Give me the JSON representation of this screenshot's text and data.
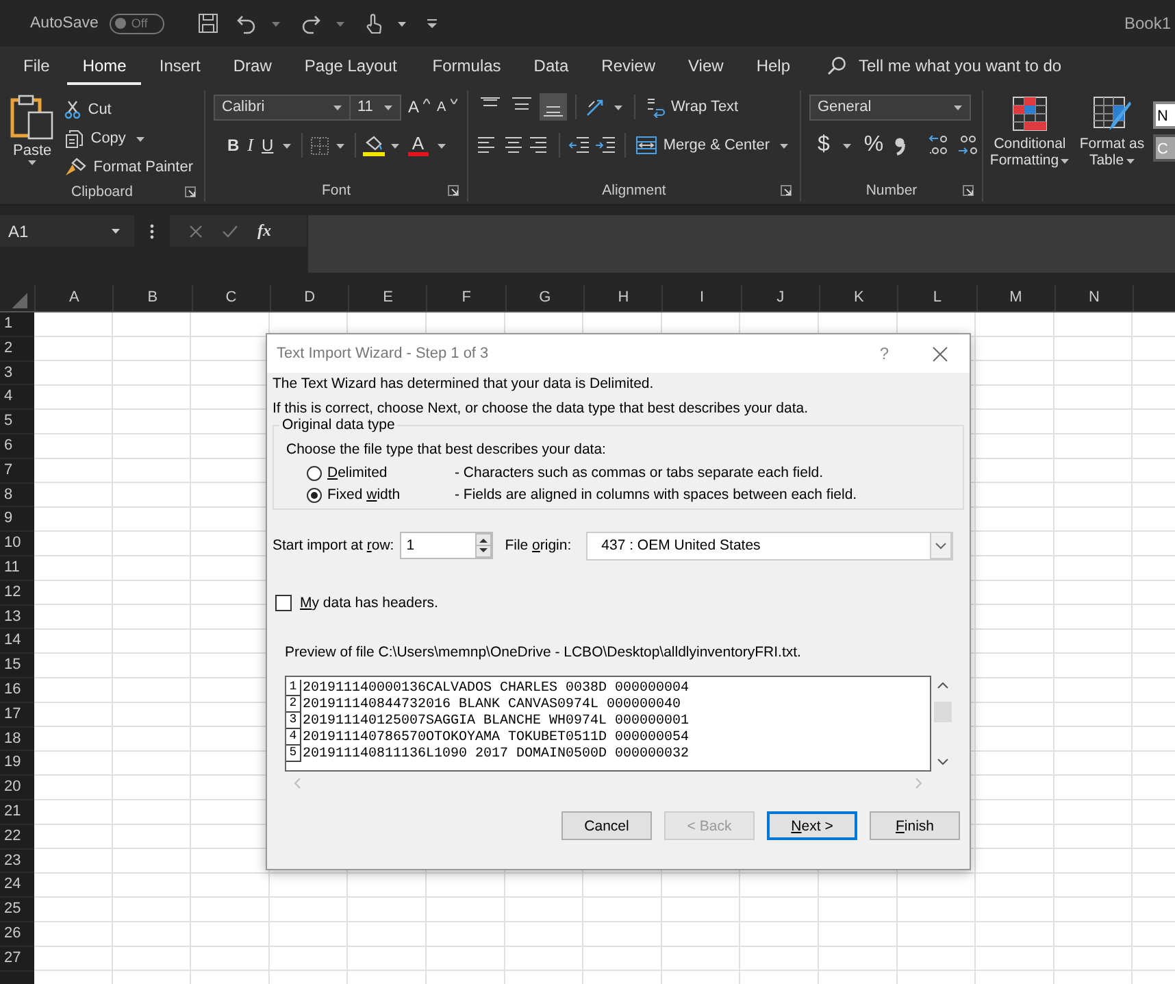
{
  "title_bar": {
    "autosave": {
      "label": "AutoSave",
      "state_text": "Off",
      "on": false
    },
    "book_title": "Book1"
  },
  "menu_tabs": [
    {
      "label": "File",
      "selected": false
    },
    {
      "label": "Home",
      "selected": true
    },
    {
      "label": "Insert",
      "selected": false
    },
    {
      "label": "Draw",
      "selected": false
    },
    {
      "label": "Page Layout",
      "selected": false
    },
    {
      "label": "Formulas",
      "selected": false
    },
    {
      "label": "Data",
      "selected": false
    },
    {
      "label": "Review",
      "selected": false
    },
    {
      "label": "View",
      "selected": false
    },
    {
      "label": "Help",
      "selected": false
    }
  ],
  "tell_me": {
    "placeholder": "Tell me what you want to do"
  },
  "ribbon": {
    "clipboard": {
      "label": "Clipboard",
      "paste": "Paste",
      "cut": "Cut",
      "copy": "Copy",
      "format_painter": "Format Painter"
    },
    "font": {
      "label": "Font",
      "font_name": "Calibri",
      "font_size": "11",
      "grow": "A",
      "shrink": "A",
      "bold": "B",
      "italic": "I",
      "underline": "U",
      "font_color": "A"
    },
    "alignment": {
      "label": "Alignment",
      "vertical_align": [
        {
          "selected": false
        },
        {
          "selected": false
        },
        {
          "selected": true
        }
      ],
      "wrap_text": "Wrap Text",
      "merge_center": "Merge & Center"
    },
    "number": {
      "label": "Number",
      "format": "General",
      "currency": "$",
      "percent": "%"
    },
    "styles": {
      "conditional_formatting": "Conditional Formatting",
      "format_as_table": "Format as Table",
      "cell_styles": [
        "N",
        "C"
      ]
    }
  },
  "formula_bar": {
    "name_box": "A1",
    "function_label": "fx"
  },
  "sheet": {
    "columns": [
      "A",
      "B",
      "C",
      "D",
      "E",
      "F",
      "G",
      "H",
      "I",
      "J",
      "K",
      "L",
      "M",
      "N"
    ],
    "rows": [
      "1",
      "2",
      "3",
      "4",
      "5",
      "6",
      "7",
      "8",
      "9",
      "10",
      "11",
      "12",
      "13",
      "14",
      "15",
      "16",
      "17",
      "18",
      "19",
      "20",
      "21",
      "22",
      "23",
      "24",
      "25",
      "26",
      "27"
    ]
  },
  "dialog": {
    "title": "Text Import Wizard - Step 1 of 3",
    "help": "?",
    "intro": [
      "The Text Wizard has determined that your data is Delimited.",
      "If this is correct, choose Next, or choose the data type that best describes your data."
    ],
    "group_title": "Original data type",
    "group_prompt": "Choose the file type that best describes your data:",
    "data_types": [
      {
        "label": {
          "key": "D",
          "post": "elimited"
        },
        "description": "- Characters such as commas or tabs separate each field.",
        "selected": false
      },
      {
        "label": {
          "pre": "Fixed ",
          "key": "w",
          "post": "idth"
        },
        "description": "- Fields are aligned in columns with spaces between each field.",
        "selected": true
      }
    ],
    "start_row": {
      "label": {
        "pre": "Start import at ",
        "key": "r",
        "post": "ow:"
      },
      "value": "1"
    },
    "file_origin": {
      "label": {
        "pre": "File ",
        "key": "o",
        "post": "rigin:"
      },
      "value": "437 : OEM United States"
    },
    "headers": {
      "label": {
        "key": "M",
        "post": "y data has headers."
      },
      "checked": false
    },
    "preview": {
      "title": "Preview of file C:\\Users\\memnp\\OneDrive - LCBO\\Desktop\\alldlyinventoryFRI.txt.",
      "lines": [
        {
          "number": "1",
          "text": "201911140000136CALVADOS CHARLES 0038D 000000004"
        },
        {
          "number": "2",
          "text": "201911140844732016 BLANK CANVAS0974L 000000040"
        },
        {
          "number": "3",
          "text": "201911140125007SAGGIA BLANCHE WH0974L 000000001"
        },
        {
          "number": "4",
          "text": "201911140786570OTOKOYAMA TOKUBET0511D 000000054"
        },
        {
          "number": "5",
          "text": "201911140811136L1090 2017 DOMAIN0500D 000000032"
        }
      ]
    },
    "buttons": [
      {
        "label": {
          "pre": "Cancel"
        },
        "default": false,
        "disabled": false
      },
      {
        "label": {
          "pre": "< Back"
        },
        "default": false,
        "disabled": true
      },
      {
        "label": {
          "key": "N",
          "post": "ext >"
        },
        "default": true,
        "disabled": false
      },
      {
        "label": {
          "key": "F",
          "post": "inish"
        },
        "default": false,
        "disabled": false
      }
    ]
  }
}
